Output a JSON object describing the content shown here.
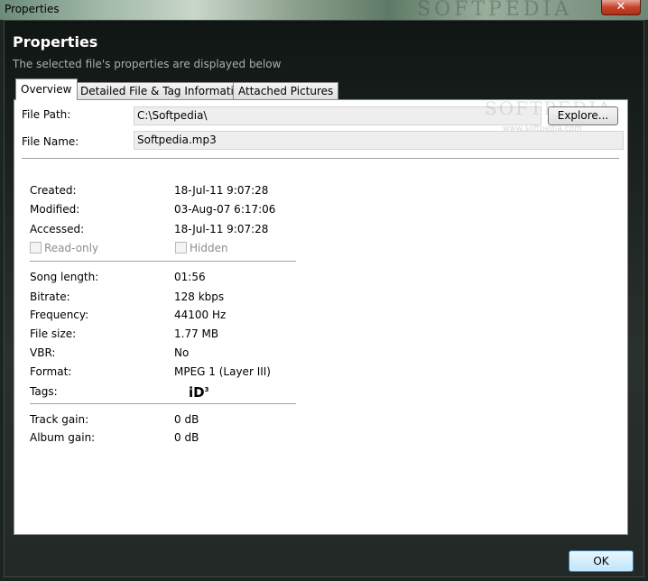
{
  "window": {
    "title": "Properties",
    "close_glyph": "✕",
    "watermark": "SOFTPEDIA"
  },
  "header": {
    "title": "Properties",
    "subtitle": "The selected file's properties are displayed below"
  },
  "tabs": [
    {
      "label": "Overview",
      "active": true
    },
    {
      "label": "Detailed File & Tag Information",
      "active": false
    },
    {
      "label": "Attached Pictures",
      "active": false
    }
  ],
  "file": {
    "path_label": "File Path:",
    "path_value": "C:\\Softpedia\\",
    "explore_label": "Explore...",
    "name_label": "File Name:",
    "name_value": "Softpedia.mp3",
    "watermark": "SOFTPEDIA",
    "watermark_url": "www.softpedia.com"
  },
  "dates": {
    "created_label": "Created:",
    "created_value": "18-Jul-11 9:07:28",
    "modified_label": "Modified:",
    "modified_value": "03-Aug-07 6:17:06",
    "accessed_label": "Accessed:",
    "accessed_value": "18-Jul-11 9:07:28",
    "readonly_label": "Read-only",
    "hidden_label": "Hidden"
  },
  "audio": {
    "length_label": "Song length:",
    "length_value": "01:56",
    "bitrate_label": "Bitrate:",
    "bitrate_value": "128 kbps",
    "frequency_label": "Frequency:",
    "frequency_value": "44100 Hz",
    "size_label": "File size:",
    "size_value": "1.77 MB",
    "vbr_label": "VBR:",
    "vbr_value": "No",
    "format_label": "Format:",
    "format_value": "MPEG 1 (Layer III)",
    "tags_label": "Tags:",
    "tags_icon": "id3-tag-icon"
  },
  "gain": {
    "track_label": "Track gain:",
    "track_value": "0 dB",
    "album_label": "Album gain:",
    "album_value": "0 dB"
  },
  "footer": {
    "ok_label": "OK"
  }
}
